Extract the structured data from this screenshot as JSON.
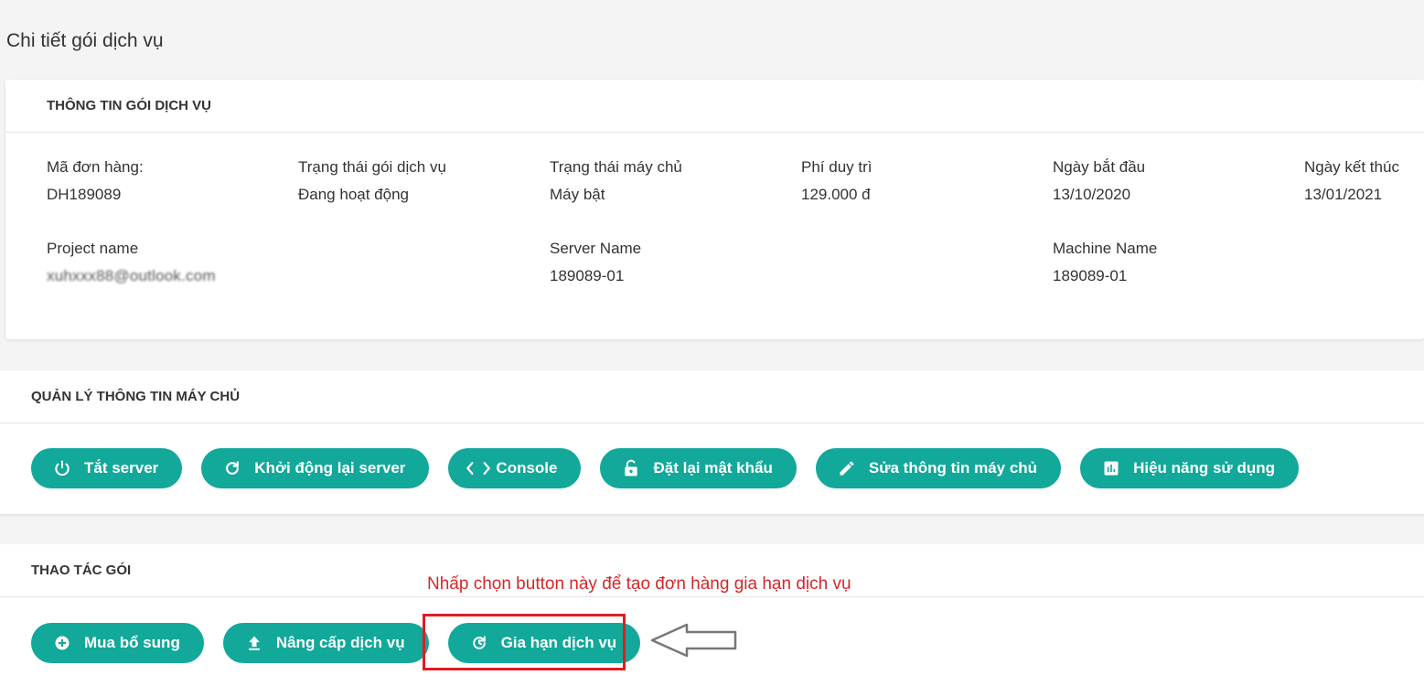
{
  "page": {
    "title": "Chi tiết gói dịch vụ"
  },
  "info_card": {
    "header": "THÔNG TIN GÓI DỊCH VỤ",
    "fields": {
      "order_id": {
        "label": "Mã đơn hàng:",
        "value": "DH189089"
      },
      "package_status": {
        "label": "Trạng thái gói dịch vụ",
        "value": "Đang hoạt động"
      },
      "server_status": {
        "label": "Trạng thái máy chủ",
        "value": "Máy bật"
      },
      "maintenance_fee": {
        "label": "Phí duy trì",
        "value": "129.000 đ"
      },
      "start_date": {
        "label": "Ngày bắt đầu",
        "value": "13/10/2020"
      },
      "end_date": {
        "label": "Ngày kết thúc",
        "value": "13/01/2021"
      },
      "project_name": {
        "label": "Project name",
        "value": "xuhxxx88@outlook.com"
      },
      "server_name": {
        "label": "Server Name",
        "value": "189089-01"
      },
      "machine_name": {
        "label": "Machine Name",
        "value": "189089-01"
      }
    }
  },
  "server_card": {
    "header": "QUẢN LÝ THÔNG TIN MÁY CHỦ",
    "buttons": {
      "shutdown": {
        "label": "Tắt server",
        "icon": "power-icon"
      },
      "restart": {
        "label": "Khởi động lại server",
        "icon": "refresh-icon"
      },
      "console": {
        "label": "Console",
        "icon": "code-icon"
      },
      "reset_password": {
        "label": "Đặt lại mật khẩu",
        "icon": "lock-icon"
      },
      "edit_server": {
        "label": "Sửa thông tin máy chủ",
        "icon": "pencil-icon"
      },
      "performance": {
        "label": "Hiệu năng sử dụng",
        "icon": "chart-icon"
      }
    }
  },
  "package_card": {
    "header": "THAO TÁC GÓI",
    "buttons": {
      "buy_more": {
        "label": "Mua bổ sung",
        "icon": "plus-circle-icon"
      },
      "upgrade": {
        "label": "Nâng cấp dịch vụ",
        "icon": "upload-icon"
      },
      "renew": {
        "label": "Gia hạn dịch vụ",
        "icon": "renew-icon"
      }
    }
  },
  "annotation": {
    "text": "Nhấp chọn button này để tạo đơn hàng gia hạn dịch vụ",
    "color": "#d62728",
    "box_color": "#e11c24"
  },
  "colors": {
    "accent": "#12a89a",
    "background": "#f4f4f4"
  }
}
